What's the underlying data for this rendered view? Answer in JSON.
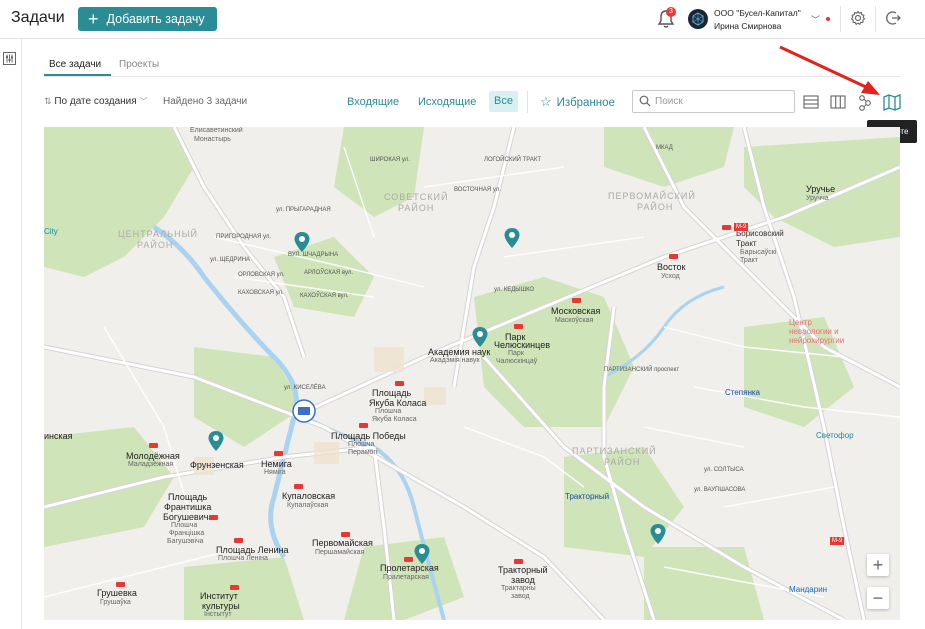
{
  "header": {
    "title": "Задачи",
    "add_task_label": "Добавить задачу",
    "notifications_count": "3",
    "org_name": "ООО \"Бусел-Капитал\"",
    "user_name": "Ирина Смирнова"
  },
  "tabs": [
    {
      "label": "Все задачи",
      "active": true
    },
    {
      "label": "Проекты",
      "active": false
    }
  ],
  "toolbar": {
    "sort_label": "По дате создания",
    "found_label": "Найдено 3 задачи",
    "filter_incoming": "Входящие",
    "filter_outgoing": "Исходящие",
    "filter_all": "Все",
    "favorites_label": "Избранное",
    "search_placeholder": "Поиск",
    "map_tooltip": "На карте"
  },
  "colors": {
    "accent": "#2a8c95",
    "accent_light": "#d8f0f2",
    "badge": "#e53935"
  },
  "map": {
    "districts": [
      "СОВЕТСКИЙ",
      "РАЙОН",
      "ЦЕНТРАЛЬНЫЙ",
      "РАЙОН",
      "ПЕРВОМАЙСКИЙ",
      "РАЙОН",
      "ПАРТИЗАНСКИЙ",
      "РАЙОН"
    ],
    "places": [
      {
        "name": "Елисаветинский",
        "sub": "Монастырь"
      },
      {
        "name": "Уручье",
        "sub": "Уручча"
      },
      {
        "name": "Борисовский",
        "sub": "Тракт"
      },
      {
        "name": "Барысаўскі",
        "sub": "Тракт"
      },
      {
        "name": "Восток",
        "sub": "Усход"
      },
      {
        "name": "Московская",
        "sub": "Маскоўская"
      },
      {
        "name": "Парк",
        "sub": "Челюскинцев"
      },
      {
        "name": "Парк",
        "sub": "Чалюскінцаў"
      },
      {
        "name": "Академия наук",
        "sub": "Акадэмія навук"
      },
      {
        "name": "Площадь",
        "sub": "Якуба Коласа"
      },
      {
        "name": "Плошча",
        "sub": "Якуба Коласа"
      },
      {
        "name": "Площадь Победы",
        "sub": "Плошча"
      },
      {
        "name": "Перамогі",
        "sub": ""
      },
      {
        "name": "Молодёжная",
        "sub": "Маладзёжная"
      },
      {
        "name": "Фрунзенская",
        "sub": ""
      },
      {
        "name": "Немига",
        "sub": "Няміга"
      },
      {
        "name": "Купаловская",
        "sub": "Купалаўская"
      },
      {
        "name": "Первомайская",
        "sub": "Першамайская"
      },
      {
        "name": "Площадь",
        "sub": "Франтишка"
      },
      {
        "name": "Богушевича",
        "sub": ""
      },
      {
        "name": "Плошча",
        "sub": "Францішка"
      },
      {
        "name": "Багушэвіча",
        "sub": ""
      },
      {
        "name": "Площадь Ленина",
        "sub": "Плошча Леніна"
      },
      {
        "name": "Пролетарская",
        "sub": "Пралетарская"
      },
      {
        "name": "Тракторный",
        "sub": "завод"
      },
      {
        "name": "Трактарны",
        "sub": "завод"
      },
      {
        "name": "Грушевка",
        "sub": "Грушаўка"
      },
      {
        "name": "Институт",
        "sub": "культуры"
      },
      {
        "name": "Інстытут",
        "sub": "культуры"
      },
      {
        "name": "Степянка",
        "sub": ""
      },
      {
        "name": "Тракторный",
        "sub": ""
      },
      {
        "name": "Светофор",
        "sub": ""
      },
      {
        "name": "Мандарин",
        "sub": ""
      },
      {
        "name": "Центр",
        "sub": "неврологии и"
      },
      {
        "name": "нейрохирургии",
        "sub": ""
      },
      {
        "name": "City",
        "sub": ""
      },
      {
        "name": "инская",
        "sub": ""
      }
    ],
    "streets": [
      "ул. ПРЫГАРАДНАЯ",
      "ПРИГОРОДНАЯ ул.",
      "ул. ЩЕДРИНА",
      "ВУЛ. ШЧАДРЫНА",
      "ОРЛОВСКАЯ ул.",
      "АРЛОЎСКАЯ вул.",
      "КАХОВСКАЯ ул.",
      "КАХОЎСКАЯ вул.",
      "ШИРОКАЯ ул.",
      "ЛОГОЙСКИЙ ТРАКТ",
      "ВОСТОЧНАЯ ул.",
      "ул. КЕДЫШКО",
      "МКАД",
      "М-9",
      "ул. ВАУПШАСОВА",
      "ул. СОЛТЫСА",
      "ПАРТИЗАНСКИЙ проспект",
      "ул. КИСЕЛЁВА"
    ],
    "zoom_in": "+",
    "zoom_out": "−"
  }
}
